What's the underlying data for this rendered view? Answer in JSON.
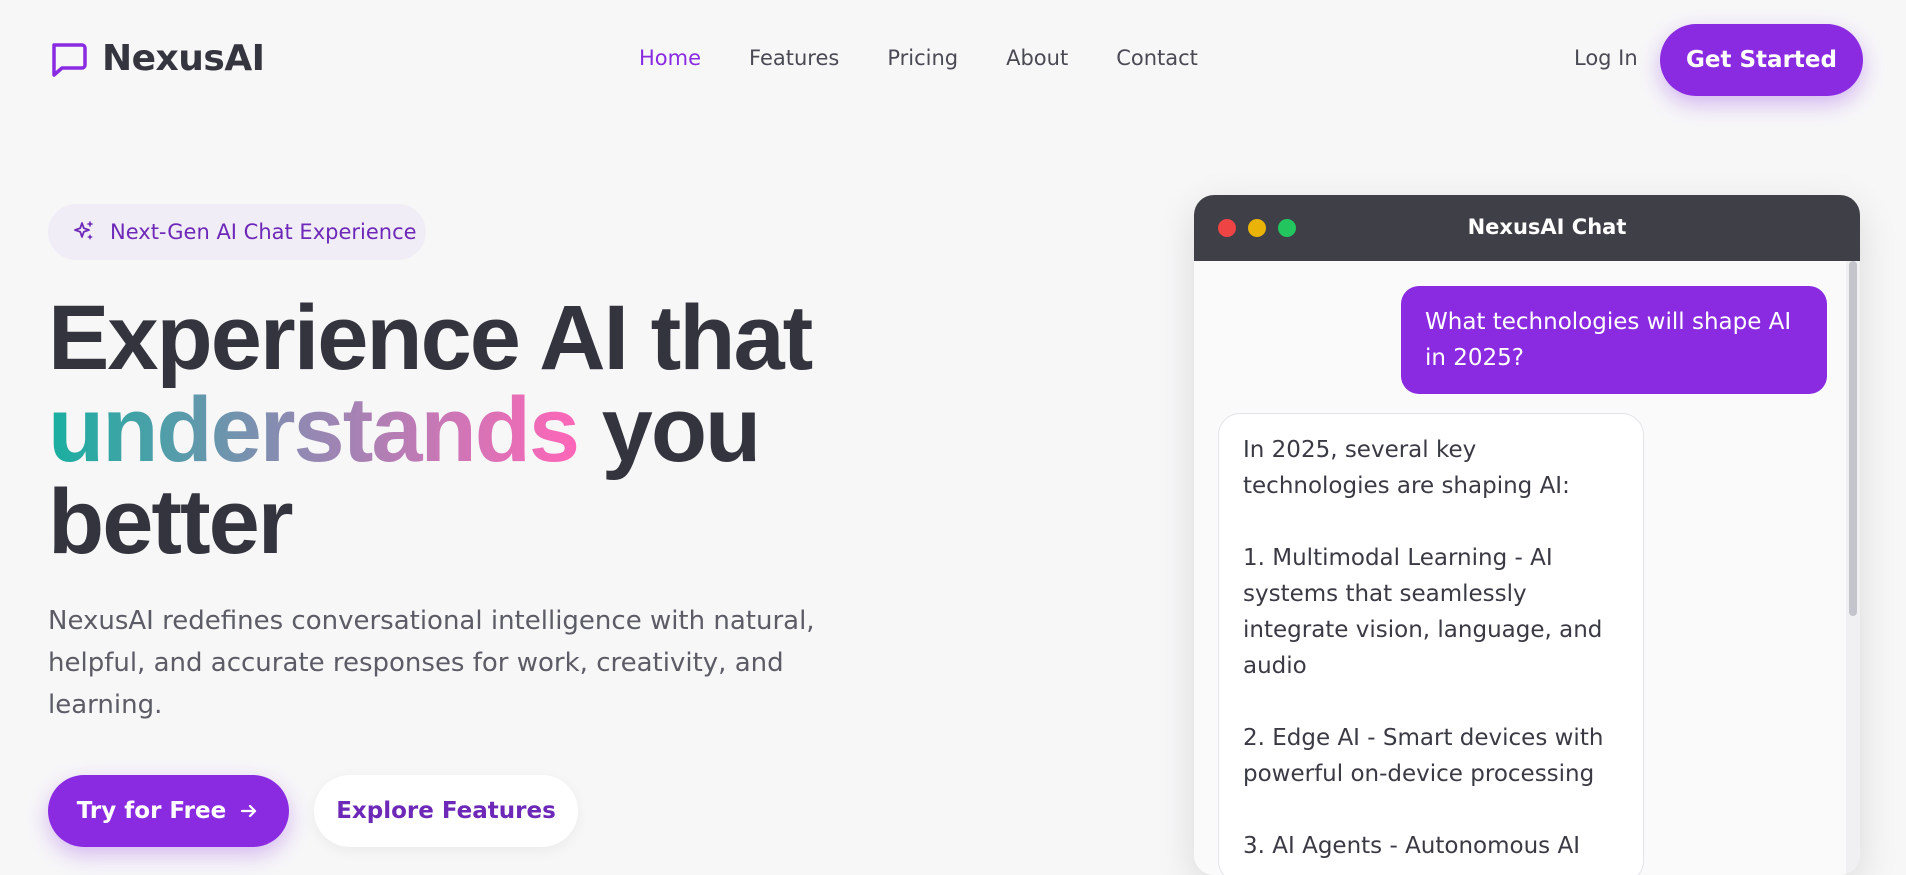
{
  "brand": {
    "name": "NexusAI",
    "accent": "#8a2be2"
  },
  "nav": {
    "links": [
      {
        "label": "Home",
        "active": true
      },
      {
        "label": "Features",
        "active": false
      },
      {
        "label": "Pricing",
        "active": false
      },
      {
        "label": "About",
        "active": false
      },
      {
        "label": "Contact",
        "active": false
      }
    ],
    "login": "Log In",
    "cta": "Get Started"
  },
  "hero": {
    "badge": "Next-Gen AI Chat Experience",
    "headline_line1": "Experience AI that",
    "headline_highlight": "understands",
    "headline_after_highlight": " you",
    "headline_line3": "better",
    "subtitle": "NexusAI redefines conversational intelligence with natural, helpful, and accurate responses for work, creativity, and learning.",
    "primary_button": "Try for Free",
    "secondary_button": "Explore Features"
  },
  "chat": {
    "title": "NexusAI Chat",
    "user_message": "What technologies will shape AI in 2025?",
    "ai_message": "In 2025, several key technologies are shaping AI:\n\n1. Multimodal Learning - AI systems that seamlessly integrate vision, language, and audio\n\n2. Edge AI - Smart devices with powerful on-device processing\n\n3. AI Agents - Autonomous AI"
  }
}
